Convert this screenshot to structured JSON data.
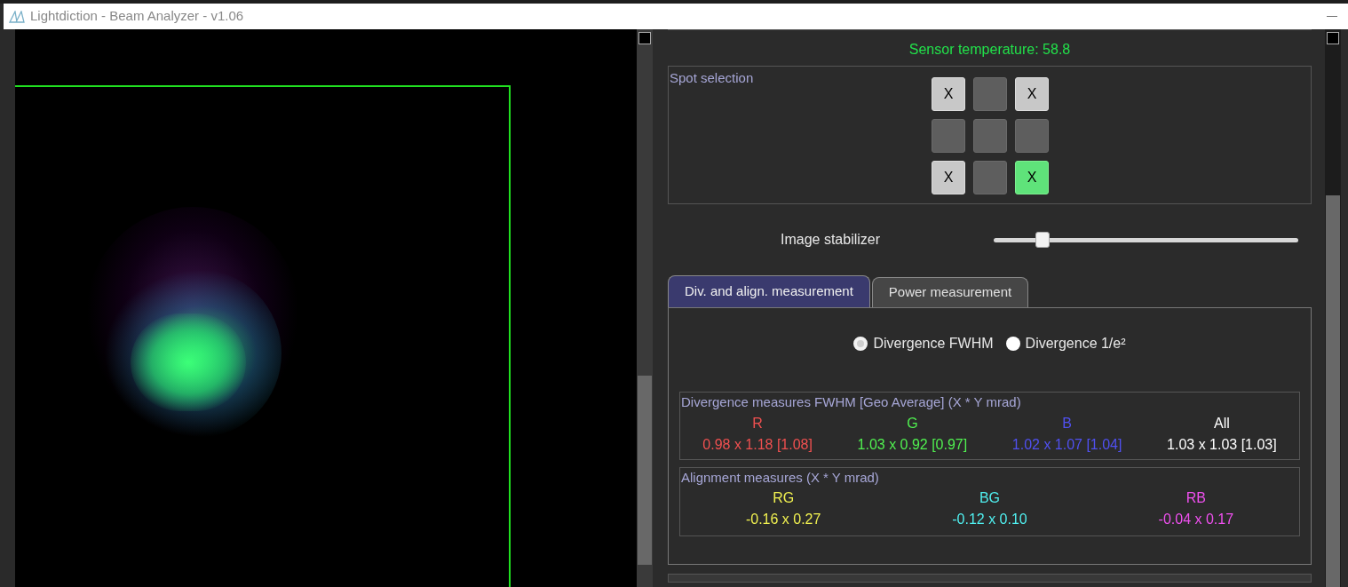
{
  "window": {
    "title": "Lightdiction - Beam Analyzer - v1.06"
  },
  "sensor_temperature": "Sensor temperature: 58.8",
  "spot_selection": {
    "title": "Spot selection",
    "cells": [
      {
        "label": "X",
        "selected": true,
        "active": false
      },
      {
        "selected": false,
        "active": false
      },
      {
        "label": "X",
        "selected": true,
        "active": false
      },
      {
        "selected": false,
        "active": false
      },
      {
        "selected": false,
        "active": false
      },
      {
        "selected": false,
        "active": false
      },
      {
        "label": "X",
        "selected": true,
        "active": false
      },
      {
        "selected": false,
        "active": false
      },
      {
        "label": "X",
        "selected": true,
        "active": true
      }
    ]
  },
  "image_stabilizer": {
    "label": "Image stabilizer",
    "level": 0.16
  },
  "tabs": [
    {
      "label": "Div. and align. measurement",
      "selected": true
    },
    {
      "label": "Power measurement",
      "selected": false
    }
  ],
  "radios": [
    {
      "label": "Divergence FWHM",
      "selected": true
    },
    {
      "label": "Divergence 1/e²",
      "selected": false
    }
  ],
  "divergence": {
    "title": "Divergence measures FWHM [Geo Average] (X * Y mrad)",
    "columns": [
      {
        "name": "R",
        "value": "0.98 x 1.18 [1.08]",
        "color": "#f05050"
      },
      {
        "name": "G",
        "value": "1.03 x 0.92 [0.97]",
        "color": "#50f050"
      },
      {
        "name": "B",
        "value": "1.02 x 1.07 [1.04]",
        "color": "#5050f0"
      },
      {
        "name": "All",
        "value": "1.03 x 1.03 [1.03]",
        "color": "#ffffff"
      }
    ]
  },
  "alignment": {
    "title": "Alignment measures (X * Y mrad)",
    "columns": [
      {
        "name": "RG",
        "value": "-0.16 x 0.27",
        "color": "#f0f050"
      },
      {
        "name": "BG",
        "value": "-0.12 x 0.10",
        "color": "#50f0f0"
      },
      {
        "name": "RB",
        "value": "-0.04 x 0.17",
        "color": "#f050f0"
      }
    ]
  }
}
